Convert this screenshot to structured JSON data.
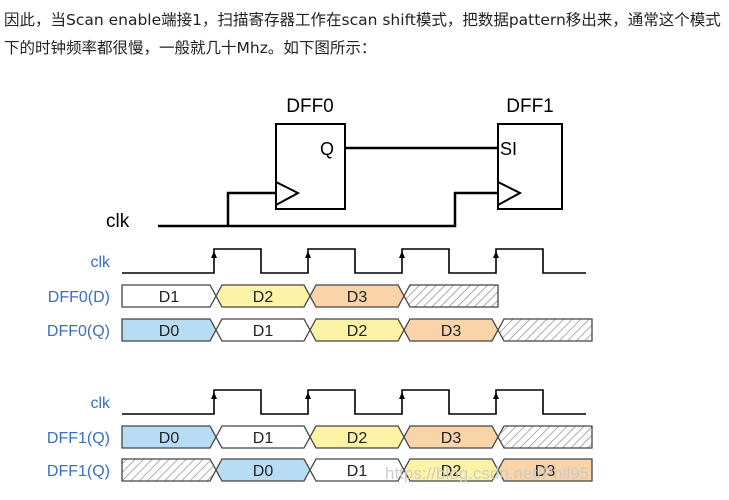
{
  "article": {
    "paragraph": "因此，当Scan enable端接1，扫描寄存器工作在scan shift模式，把数据pattern移出来，通常这个模式下的时钟频率都很慢，一般就几十Mhz。如下图所示："
  },
  "diagram": {
    "dff0_label": "DFF0",
    "dff1_label": "DFF1",
    "q_pin": "Q",
    "si_pin": "SI",
    "clk_label": "clk",
    "watermark": "https://blog.csdn.net/Phil95"
  },
  "timing_groups": [
    {
      "clk_label": "clk",
      "rows": [
        {
          "label": "DFF0(D)",
          "segments": [
            {
              "text": "D1",
              "color": "#ffffff"
            },
            {
              "text": "D2",
              "color": "#fdf3a6"
            },
            {
              "text": "D3",
              "color": "#f8d4a8"
            },
            {
              "text": "",
              "color": "hatch"
            }
          ]
        },
        {
          "label": "DFF0(Q)",
          "segments": [
            {
              "text": "D0",
              "color": "#b9dcf5"
            },
            {
              "text": "D1",
              "color": "#ffffff"
            },
            {
              "text": "D2",
              "color": "#fdf3a6"
            },
            {
              "text": "D3",
              "color": "#f8d4a8"
            },
            {
              "text": "",
              "color": "hatch"
            }
          ]
        }
      ]
    },
    {
      "clk_label": "clk",
      "rows": [
        {
          "label": "DFF1(Q)",
          "segments": [
            {
              "text": "D0",
              "color": "#b9dcf5"
            },
            {
              "text": "D1",
              "color": "#ffffff"
            },
            {
              "text": "D2",
              "color": "#fdf3a6"
            },
            {
              "text": "D3",
              "color": "#f8d4a8"
            },
            {
              "text": "",
              "color": "hatch"
            }
          ]
        },
        {
          "label": "DFF1(Q)",
          "segments": [
            {
              "text": "",
              "color": "hatch"
            },
            {
              "text": "D0",
              "color": "#b9dcf5"
            },
            {
              "text": "D1",
              "color": "#ffffff"
            },
            {
              "text": "D2",
              "color": "#fdf3a6"
            },
            {
              "text": "D3",
              "color": "#f8d4a8"
            }
          ]
        }
      ]
    }
  ],
  "colors": {
    "label_blue": "#3a6fbf",
    "line": "#000000",
    "wave_stroke": "#444444"
  }
}
